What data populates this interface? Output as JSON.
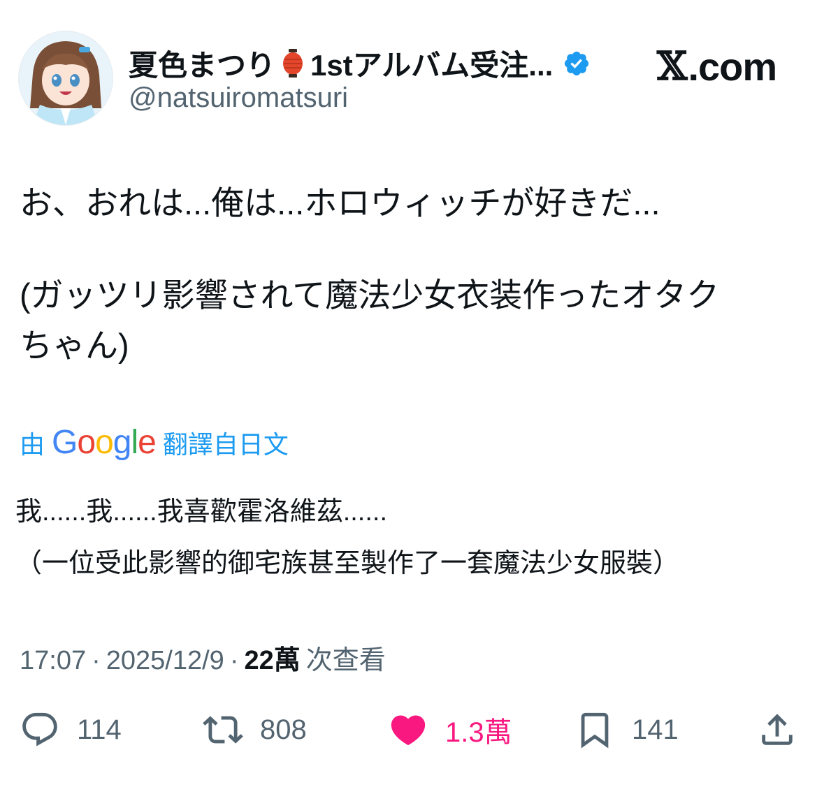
{
  "author": {
    "display_name": "夏色まつり",
    "name_suffix": "1stアルバム受注...",
    "handle": "@natsuiromatsuri",
    "verified": true,
    "lantern_icon": "lantern-emoji-icon",
    "badge_icon": "verified-badge-icon"
  },
  "site": {
    "label": ".com",
    "mark": "𝕏"
  },
  "tweet": {
    "lines": [
      "お、おれは...俺は...ホロウィッチが好きだ...",
      "(ガッツリ影響されて魔法少女衣装作ったオタク",
      "ちゃん)"
    ]
  },
  "translation": {
    "prefix": "由",
    "provider": "Google",
    "suffix": "翻譯自日文",
    "lines": [
      "我......我......我喜歡霍洛維茲......",
      "（一位受此影響的御宅族甚至製作了一套魔法少女服裝）"
    ]
  },
  "meta": {
    "time": "17:07",
    "separator": "·",
    "date": "2025/12/9",
    "views": "22萬",
    "views_label": "次查看"
  },
  "actions": {
    "replies": "114",
    "reposts": "808",
    "likes": "1.3萬",
    "bookmarks": "141",
    "colors": {
      "liked": "#f91880",
      "muted": "#536471"
    }
  }
}
